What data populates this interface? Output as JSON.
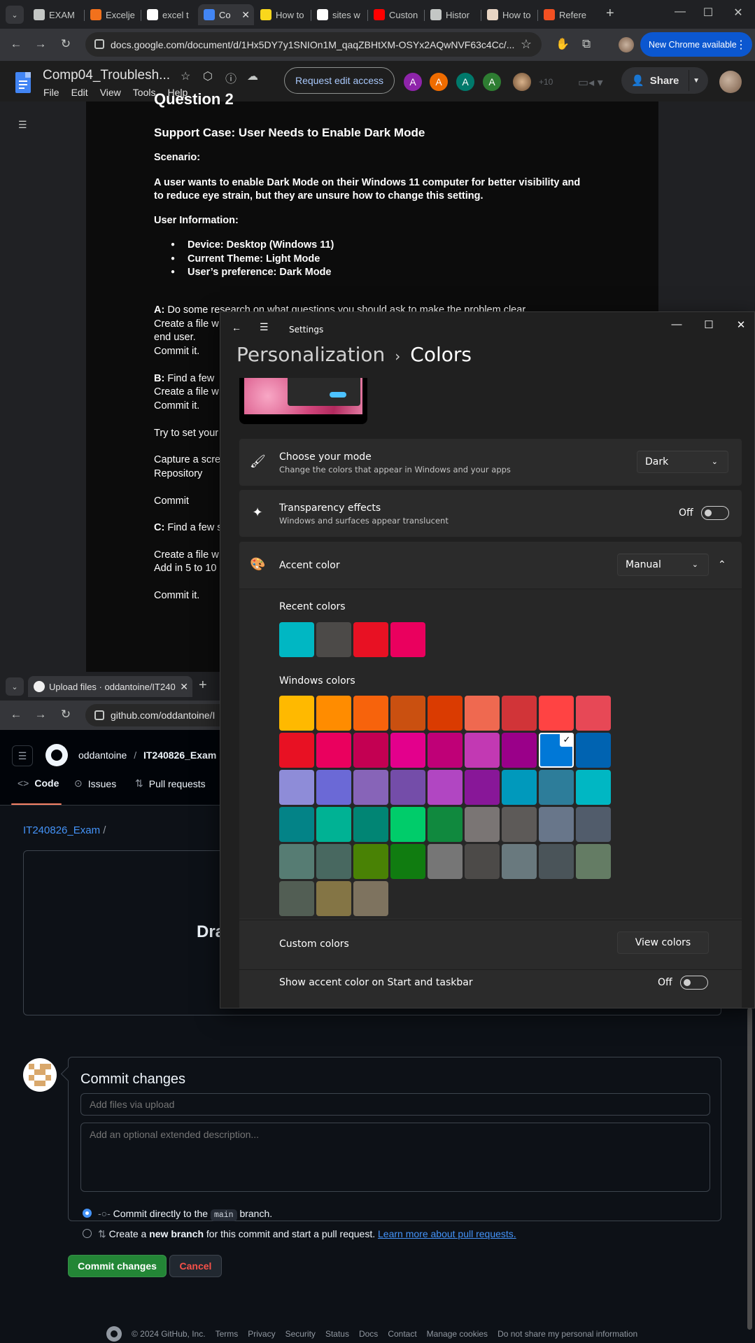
{
  "browser_top": {
    "tabs": [
      {
        "label": "EXAM",
        "icon": "classroom-icon",
        "color": "#c4c7c5"
      },
      {
        "label": "Excelje",
        "icon": "excel-icon",
        "color": "#f2711c"
      },
      {
        "label": "excel t",
        "icon": "google-icon",
        "color": "#ffffff"
      },
      {
        "label": "Co",
        "icon": "docs-icon",
        "color": "#4285f4"
      },
      {
        "label": "How to",
        "icon": "w-icon",
        "color": "#f9d71c"
      },
      {
        "label": "sites w",
        "icon": "google-icon",
        "color": "#ffffff"
      },
      {
        "label": "Custon",
        "icon": "youtube-icon",
        "color": "#ff0000"
      },
      {
        "label": "Histor",
        "icon": "history-icon",
        "color": "#c4c7c5"
      },
      {
        "label": "How to",
        "icon": "wikihow-icon",
        "color": "#e8d5c4"
      },
      {
        "label": "Refere",
        "icon": "microsoft-icon",
        "color": "#f25022"
      }
    ],
    "url": "docs.google.com/document/d/1Hx5DY7y1SNIOn1M_qaqZBHtXM-OSYx2AQwNVF63c4Cc/...",
    "new_chrome": "New Chrome available"
  },
  "docs": {
    "title": "Comp04_Troublesh...",
    "menu": [
      "File",
      "Edit",
      "View",
      "Tools",
      "Help"
    ],
    "request_edit": "Request edit access",
    "share": "Share",
    "collaborators": [
      {
        "initial": "A",
        "color": "#8e24aa"
      },
      {
        "initial": "A",
        "color": "#ef6c00"
      },
      {
        "initial": "A",
        "color": "#00796b"
      },
      {
        "initial": "A",
        "color": "#2e7d32"
      }
    ],
    "more_count": "+10",
    "content": {
      "heading_partial": "Question 2",
      "case_title": "Support Case: User Needs to Enable Dark Mode",
      "scenario_label": "Scenario:",
      "scenario_line1": "A user wants to enable Dark Mode on their Windows 11 computer for better visibility and",
      "scenario_line2": "to reduce eye strain, but they are unsure how to change this setting.",
      "user_info_label": "User Information:",
      "bullets": [
        "Device: Desktop (Windows 11)",
        "Current Theme: Light Mode",
        "User’s preference: Dark Mode"
      ],
      "a_prefix": "A:",
      "a_line1": "Do some research on what questions you should ask to make the problem clear.",
      "a_line2": "Create a file w",
      "a_line3": "end user.",
      "a_line4": "Commit it.",
      "b_prefix": "B:",
      "b_line1": "Find a  few",
      "b_line2": "Create a  file w",
      "b_line3": "Commit it.",
      "try_line": "Try to set your",
      "capture_line1": "Capture a scre",
      "capture_line2": "Repository",
      "commit_line": "Commit",
      "c_prefix": "C:",
      "c_line1": "Find a few s",
      "c_line2": "Create a  file w",
      "c_line3": "Add in 5 to 10",
      "c_line4": "Commit it."
    }
  },
  "browser_bottom": {
    "tab_label": "Upload files · oddantoine/IT240",
    "url": "github.com/oddantoine/I"
  },
  "github": {
    "owner": "oddantoine",
    "separator": "/",
    "repo": "IT240826_Exam",
    "nav": [
      "Code",
      "Issues",
      "Pull requests"
    ],
    "path_repo": "IT240826_Exam",
    "path_sep": "/",
    "drop_text": "Dra",
    "commit_title": "Commit changes",
    "summary_placeholder": "Add files via upload",
    "description_placeholder": "Add an optional extended description...",
    "option1_pre": "Commit directly to the",
    "option1_branch": "main",
    "option1_post": "branch.",
    "option2_pre": "Create a",
    "option2_bold": "new branch",
    "option2_post": "for this commit and start a pull request.",
    "option2_link": "Learn more about pull requests.",
    "commit_button": "Commit changes",
    "cancel_button": "Cancel",
    "footer": [
      "© 2024 GitHub, Inc.",
      "Terms",
      "Privacy",
      "Security",
      "Status",
      "Docs",
      "Contact",
      "Manage cookies",
      "Do not share my personal information"
    ]
  },
  "settings": {
    "window_title": "Settings",
    "breadcrumb_parent": "Personalization",
    "breadcrumb_sep": "›",
    "breadcrumb_current": "Colors",
    "mode": {
      "title": "Choose your mode",
      "desc": "Change the colors that appear in Windows and your apps",
      "value": "Dark"
    },
    "transparency": {
      "title": "Transparency effects",
      "desc": "Windows and surfaces appear translucent",
      "state": "Off"
    },
    "accent": {
      "title": "Accent color",
      "value": "Manual"
    },
    "recent_label": "Recent colors",
    "recent_colors": [
      "#00b7c3",
      "#4c4a48",
      "#e81123",
      "#ea005e"
    ],
    "windows_label": "Windows colors",
    "windows_colors": [
      [
        "#ffb900",
        "#ff8c00",
        "#f7630c",
        "#ca5010",
        "#da3b01",
        "#ef6950",
        "#d13438",
        "#ff4343",
        "#e74856"
      ],
      [
        "#e81123",
        "#ea005e",
        "#c30052",
        "#e3008c",
        "#bf0077",
        "#c239b3",
        "#9a0089",
        "#0078d7",
        "#0063b1"
      ],
      [
        "#8e8cd8",
        "#6b69d6",
        "#8764b8",
        "#744da9",
        "#b146c2",
        "#881798",
        "#0099bc",
        "#2d7d9a",
        "#00b7c3"
      ],
      [
        "#038387",
        "#00b294",
        "#018574",
        "#00cc6a",
        "#10893e",
        "#7a7574",
        "#5d5a58",
        "#68768a",
        "#515c6b"
      ],
      [
        "#567c73",
        "#486860",
        "#498205",
        "#107c10",
        "#767676",
        "#4c4a48",
        "#69797e",
        "#4a5459",
        "#647c64"
      ],
      [
        "#525e54",
        "#847545",
        "#7e735f"
      ]
    ],
    "selected_color": "#0078d7",
    "custom_label": "Custom colors",
    "view_colors": "View colors",
    "taskbar_label": "Show accent color on Start and taskbar",
    "taskbar_state": "Off"
  }
}
